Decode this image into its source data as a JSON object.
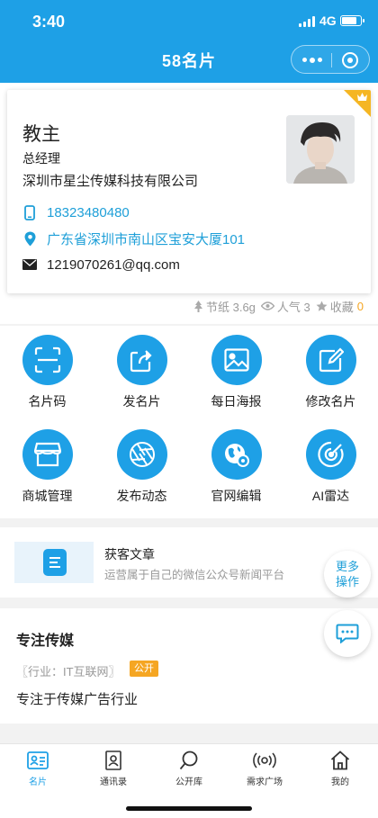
{
  "status": {
    "time": "3:40",
    "network": "4G"
  },
  "nav": {
    "title": "58名片"
  },
  "card": {
    "name": "教主",
    "position": "总经理",
    "company": "深圳市星尘传媒科技有限公司",
    "phone": "18323480480",
    "address": "广东省深圳市南山区宝安大厦101",
    "email": "1219070261@qq.com"
  },
  "stats": {
    "paper": "节纸 3.6g",
    "popularity": "人气 3",
    "favorite": "收藏",
    "favorite_count": "0"
  },
  "grid": [
    {
      "label": "名片码",
      "icon": "scan-icon"
    },
    {
      "label": "发名片",
      "icon": "share-icon"
    },
    {
      "label": "每日海报",
      "icon": "image-icon"
    },
    {
      "label": "修改名片",
      "icon": "edit-icon"
    },
    {
      "label": "商城管理",
      "icon": "shop-icon"
    },
    {
      "label": "发布动态",
      "icon": "aperture-icon"
    },
    {
      "label": "官网编辑",
      "icon": "globe-gear-icon"
    },
    {
      "label": "AI雷达",
      "icon": "radar-icon"
    }
  ],
  "article": {
    "title": "获客文章",
    "subtitle": "运营属于自己的微信公众号新闻平台"
  },
  "more": {
    "line1": "更多",
    "line2": "操作"
  },
  "profile": {
    "title": "专注传媒",
    "industry": "〖行业：IT互联网〗",
    "badge": "公开",
    "description": "专注于传媒广告行业"
  },
  "tabs": [
    {
      "label": "名片",
      "icon": "card-icon",
      "active": true
    },
    {
      "label": "通讯录",
      "icon": "contacts-icon"
    },
    {
      "label": "公开库",
      "icon": "search-icon"
    },
    {
      "label": "需求广场",
      "icon": "broadcast-icon"
    },
    {
      "label": "我的",
      "icon": "home-icon"
    }
  ],
  "colors": {
    "primary": "#1ea0e6",
    "accent": "#f5a623"
  }
}
